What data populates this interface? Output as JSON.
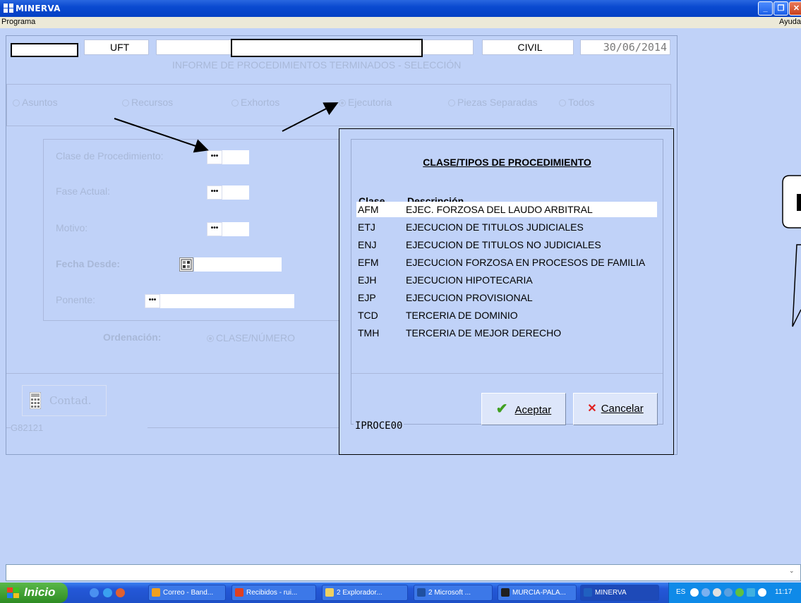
{
  "window": {
    "title": "MINERVA"
  },
  "menu": {
    "left": "Programa",
    "right": "Ayuda"
  },
  "form": {
    "field_uft": "UFT",
    "field_civil": "CIVIL",
    "field_date": "30/06/2014",
    "subtitle": "INFORME DE PROCEDIMIENTOS TERMINADOS - SELECCIÓN",
    "radios": [
      "Asuntos",
      "Recursos",
      "Exhortos",
      "Ejecutoria",
      "Piezas Separadas",
      "Todos"
    ],
    "selected_radio": "Ejecutoria",
    "labels": {
      "clase": "Clase de Procedimiento:",
      "fase": "Fase Actual:",
      "motivo": "Motivo:",
      "fecha": "Fecha Desde:",
      "ponente": "Ponente:",
      "ordenacion": "Ordenación:",
      "orden_option": "CLASE/NÚMERO"
    },
    "dots_label": "•••",
    "contad_label": "Contad.",
    "footer_code": "G82121"
  },
  "dialog": {
    "title": "CLASE/TIPOS DE PROCEDIMIENTO",
    "col_clase": "Clase",
    "col_descripcion": "Descripción",
    "rows": [
      {
        "clase": "AFM",
        "descripcion": "EJEC. FORZOSA DEL LAUDO ARBITRAL"
      },
      {
        "clase": "ETJ",
        "descripcion": "EJECUCION DE TITULOS JUDICIALES"
      },
      {
        "clase": "ENJ",
        "descripcion": "EJECUCION DE TITULOS NO JUDICIALES"
      },
      {
        "clase": "EFM",
        "descripcion": "EJECUCION FORZOSA EN PROCESOS DE FAMILIA"
      },
      {
        "clase": "EJH",
        "descripcion": "EJECUCION HIPOTECARIA"
      },
      {
        "clase": "EJP",
        "descripcion": "EJECUCION PROVISIONAL"
      },
      {
        "clase": "TCD",
        "descripcion": "TERCERIA DE DOMINIO"
      },
      {
        "clase": "TMH",
        "descripcion": "TERCERIA DE MEJOR DERECHO"
      }
    ],
    "selected_row": 0,
    "accept_label": "Aceptar",
    "cancel_label": "Cancelar",
    "frame_code": "IPROCE00"
  },
  "taskbar": {
    "start": "Inicio",
    "tasks": [
      {
        "label": "Correo - Band...",
        "icon_color": "#f0a020"
      },
      {
        "label": "Recibidos - rui...",
        "icon_color": "#e04020"
      },
      {
        "label": "2 Explorador...",
        "icon_color": "#f0d060"
      },
      {
        "label": "2 Microsoft ...",
        "icon_color": "#2050a0"
      },
      {
        "label": "MURCIA-PALA...",
        "icon_color": "#202020"
      },
      {
        "label": "MINERVA",
        "icon_color": "#2060c0"
      }
    ],
    "lang": "ES",
    "clock": "11:17"
  }
}
